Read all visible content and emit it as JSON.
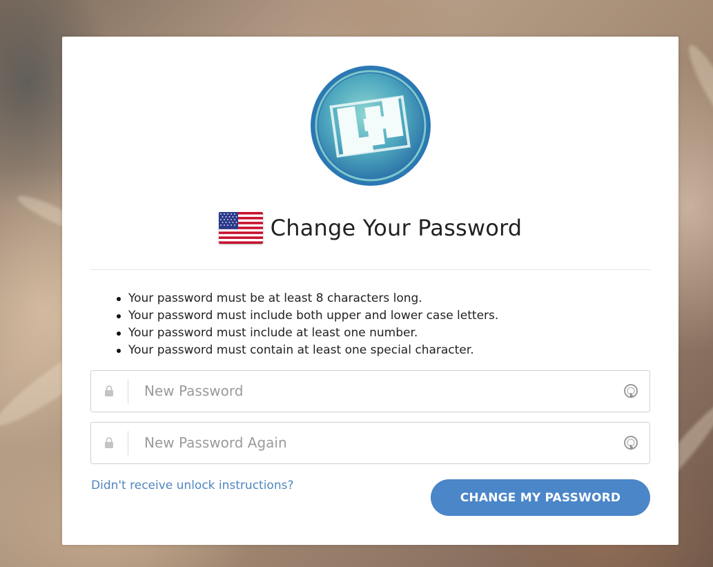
{
  "page": {
    "title": "Change Your Password",
    "language_flag_icon": "us-flag-icon",
    "logo_icon": "company-logo-icon"
  },
  "colors": {
    "accent": "#4a86c8",
    "link": "#4f85bf",
    "logo_blue": "#2d7fb5",
    "logo_teal": "#5cb4bf"
  },
  "requirements": [
    "Your password must be at least 8 characters long.",
    "Your password must include both upper and lower case letters.",
    "Your password must include at least one number.",
    "Your password must contain at least one special character."
  ],
  "form": {
    "new_password": {
      "value": "",
      "placeholder": "New Password",
      "icon": "lock-icon",
      "addon_icon": "password-manager-icon"
    },
    "new_password_again": {
      "value": "",
      "placeholder": "New Password Again",
      "icon": "lock-icon",
      "addon_icon": "password-manager-icon"
    },
    "help_link": "Didn't receive unlock instructions?",
    "submit_label": "CHANGE MY PASSWORD"
  }
}
